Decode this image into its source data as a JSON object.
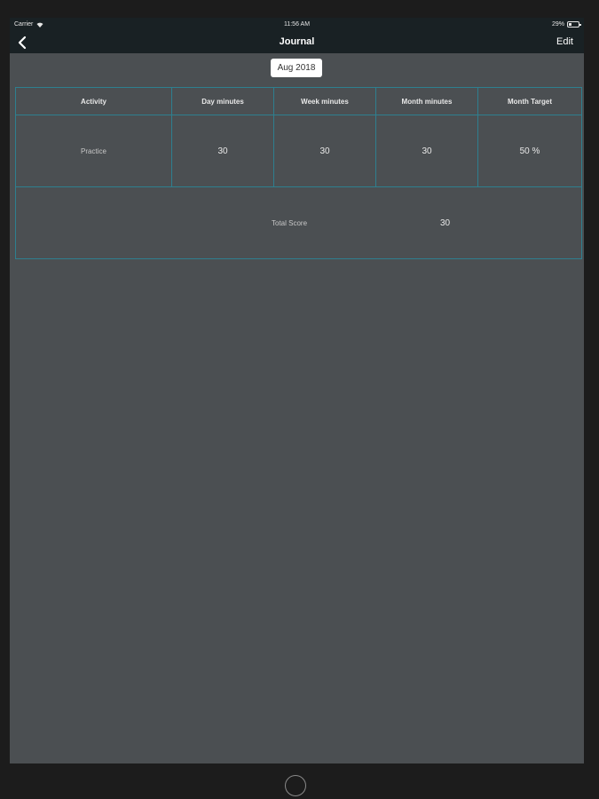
{
  "status_bar": {
    "carrier": "Carrier",
    "time": "11:56 AM",
    "battery": "29%"
  },
  "nav": {
    "title": "Journal",
    "edit_label": "Edit",
    "back_icon": "chevron-left-icon"
  },
  "month_selector": {
    "label": "Aug 2018"
  },
  "table": {
    "headers": [
      "Activity",
      "Day minutes",
      "Week minutes",
      "Month minutes",
      "Month Target"
    ],
    "rows": [
      {
        "activity": "Practice",
        "day": "30",
        "week": "30",
        "month": "30",
        "target": "50 %"
      }
    ],
    "total": {
      "label": "Total Score",
      "value": "30"
    }
  },
  "colors": {
    "nav_bg": "#192124",
    "content_bg": "#4b4f52",
    "grid_line": "#2e7f8f"
  }
}
